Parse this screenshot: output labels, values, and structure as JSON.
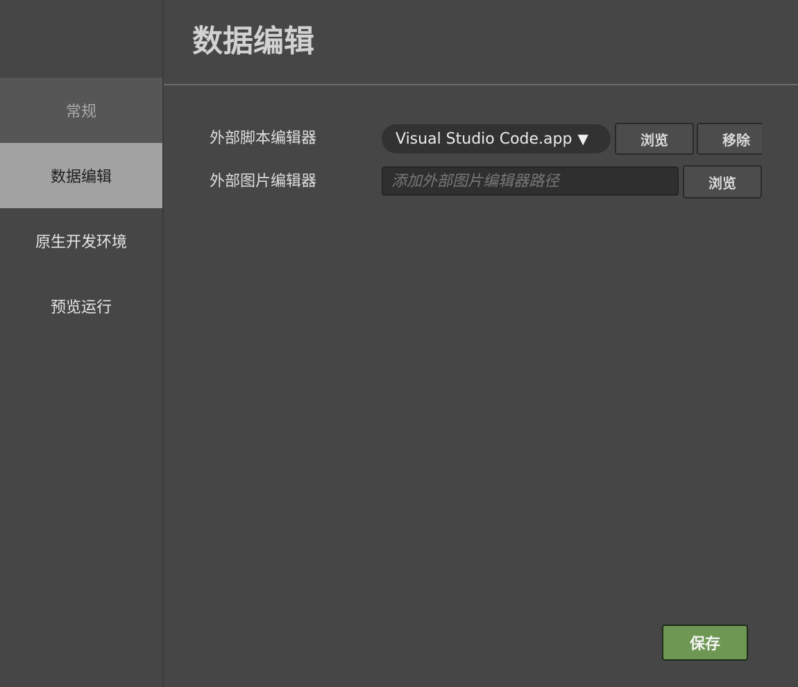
{
  "sidebar": {
    "items": [
      {
        "label": "常规"
      },
      {
        "label": "数据编辑"
      },
      {
        "label": "原生开发环境"
      },
      {
        "label": "预览运行"
      }
    ]
  },
  "header": {
    "title": "数据编辑"
  },
  "form": {
    "script_editor": {
      "label": "外部脚本编辑器",
      "selected": "Visual Studio Code.app",
      "caret": "▼",
      "browse_label": "浏览",
      "remove_label": "移除"
    },
    "image_editor": {
      "label": "外部图片编辑器",
      "value": "",
      "placeholder": "添加外部图片编辑器路径",
      "browse_label": "浏览"
    }
  },
  "footer": {
    "save_label": "保存"
  },
  "colors": {
    "background": "#464646",
    "selected_item": "#a3a3a3",
    "save_accent": "#6e9754"
  }
}
